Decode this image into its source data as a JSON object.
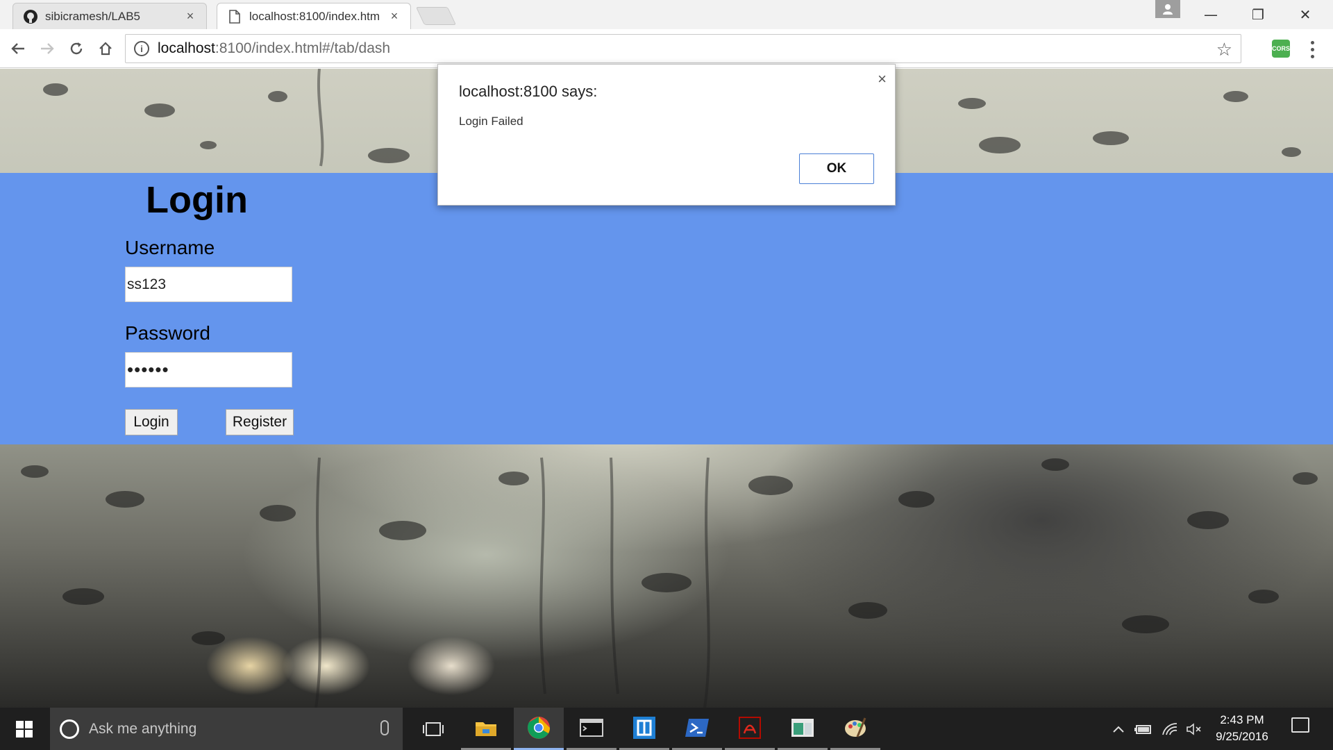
{
  "browser": {
    "tabs": [
      {
        "label": "sibicramesh/LAB5",
        "close": "×",
        "icon": "github-icon"
      },
      {
        "label": "localhost:8100/index.htm",
        "close": "×",
        "icon": "page-icon"
      }
    ],
    "window_controls": {
      "minimize": "—",
      "restore": "❐",
      "close": "✕"
    },
    "url": {
      "host": "localhost",
      "rest": ":8100/index.html#/tab/dash"
    },
    "extension_label": "CORS"
  },
  "page": {
    "title": "Login",
    "username_label": "Username",
    "username_value": "ss123",
    "password_label": "Password",
    "password_mask": "••••••",
    "login_button": "Login",
    "register_button": "Register"
  },
  "alert": {
    "title": "localhost:8100 says:",
    "message": "Login Failed",
    "ok": "OK",
    "close": "×"
  },
  "taskbar": {
    "search_placeholder": "Ask me anything",
    "time": "2:43 PM",
    "date": "9/25/2016",
    "apps": [
      "task-view-icon",
      "file-explorer-icon",
      "chrome-icon",
      "terminal-icon",
      "app-icon",
      "powershell-icon",
      "acrobat-icon",
      "window-app-icon",
      "paint-icon"
    ]
  },
  "colors": {
    "login_band": "#6495ed",
    "taskbar": "#1f1f1f"
  }
}
